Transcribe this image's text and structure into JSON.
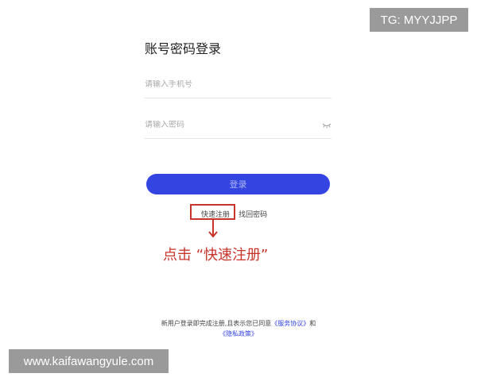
{
  "badge": {
    "text": "TG: MYYJJPP"
  },
  "login": {
    "title": "账号密码登录",
    "phone_placeholder": "请输入手机号",
    "password_placeholder": "请输入密码",
    "login_label": "登录"
  },
  "links": {
    "register_label": "快速注册",
    "separator": "|",
    "recover_label": "找回密码"
  },
  "annotation": {
    "text": "点击 “快速注册”"
  },
  "footer": {
    "line1_prefix": "新用户登录即完成注册,且表示您已同意",
    "service_agreement": "《服务协议》",
    "and_text": "和",
    "privacy_policy": "《隐私政策》"
  },
  "watermark": {
    "text": "www.kaifawangyule.com"
  },
  "colors": {
    "accent": "#3344e0",
    "annotation": "#c8332a",
    "badge_bg": "#9a9a9a"
  }
}
